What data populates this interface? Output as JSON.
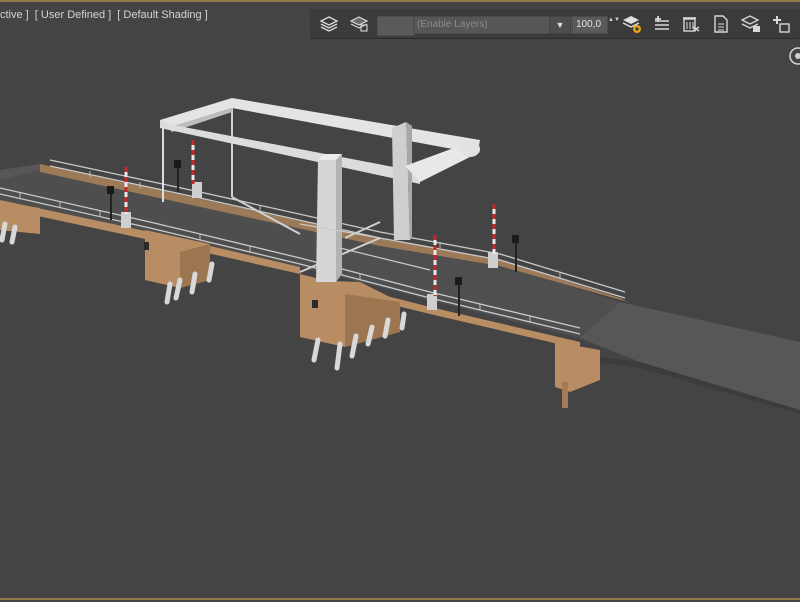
{
  "viewport": {
    "labels": [
      "ctive ]",
      "[ User Defined ]",
      "[ Default Shading ]"
    ]
  },
  "toolbar": {
    "layer_placeholder": "(Enable Layers)",
    "opacity_value": "100,0",
    "dropdown_arrow": "▼",
    "spinner_arrows": "▲▼",
    "icons": [
      "layers-stack-icon",
      "layers-alt-icon",
      "layer-settings-icon",
      "add-layer-icon",
      "delete-layer-icon",
      "layer-document-icon",
      "layer-selection-icon",
      "add-to-layer-icon"
    ]
  },
  "colors": {
    "viewport_bg": "#444444",
    "toolbar_bg": "#3b3b3b",
    "frame_accent": "#8f7a44",
    "deck": "#4f4f4f",
    "pier_wood": "#b88d64",
    "steel": "#d6d6d6"
  }
}
